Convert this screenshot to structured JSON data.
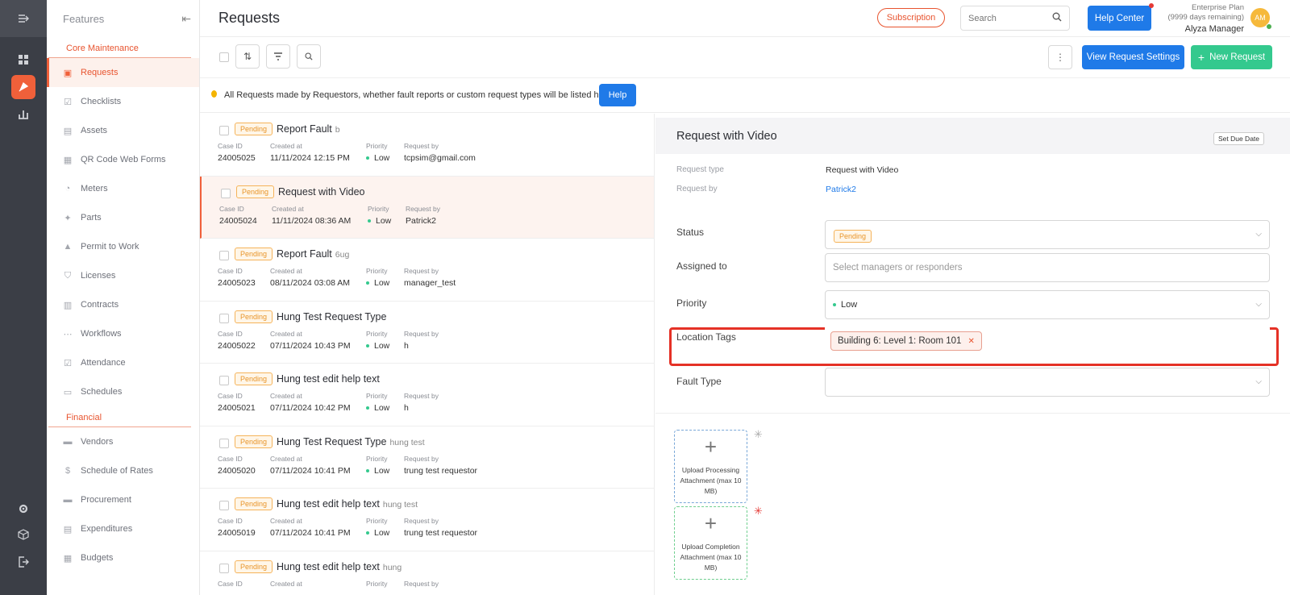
{
  "app": {
    "page_title": "Requests",
    "features_title": "Features"
  },
  "colors": {
    "accent": "#f0603a",
    "primary": "#1f7ae8",
    "success": "#34c98e",
    "pending": "#e8952a",
    "rail": "#3b3e46"
  },
  "rail": {
    "items": [
      {
        "icon": "dashboard-icon"
      },
      {
        "icon": "rocket-icon",
        "active": true
      },
      {
        "icon": "analytics-icon"
      },
      {
        "icon": "settings-gear-icon"
      },
      {
        "icon": "cube-icon"
      },
      {
        "icon": "logout-icon"
      }
    ]
  },
  "sidebar": {
    "sections": [
      {
        "title": "Core Maintenance",
        "items": [
          {
            "label": "Requests",
            "icon": "request-icon",
            "active": true
          },
          {
            "label": "Checklists",
            "icon": "checklist-icon"
          },
          {
            "label": "Assets",
            "icon": "asset-icon"
          },
          {
            "label": "QR Code Web Forms",
            "icon": "qr-code-icon"
          },
          {
            "label": "Meters",
            "icon": "meter-icon"
          },
          {
            "label": "Parts",
            "icon": "parts-icon"
          },
          {
            "label": "Permit to Work",
            "icon": "permit-icon"
          },
          {
            "label": "Licenses",
            "icon": "shield-icon"
          },
          {
            "label": "Contracts",
            "icon": "contract-icon"
          },
          {
            "label": "Workflows",
            "icon": "workflow-icon"
          },
          {
            "label": "Attendance",
            "icon": "attendance-icon"
          },
          {
            "label": "Schedules",
            "icon": "calendar-icon"
          }
        ]
      },
      {
        "title": "Financial",
        "items": [
          {
            "label": "Vendors",
            "icon": "vendor-icon"
          },
          {
            "label": "Schedule of Rates",
            "icon": "dollar-icon"
          },
          {
            "label": "Procurement",
            "icon": "procurement-icon"
          },
          {
            "label": "Expenditures",
            "icon": "expenditure-icon"
          },
          {
            "label": "Budgets",
            "icon": "budget-icon"
          }
        ]
      }
    ]
  },
  "header": {
    "subscription_label": "Subscription",
    "search_placeholder": "Search",
    "help_center_label": "Help Center",
    "plan_name": "Enterprise Plan",
    "plan_remaining": "(9999 days remaining)",
    "user_name": "Alyza Manager",
    "avatar_initials": "AM"
  },
  "toolbar": {
    "view_settings_label": "View Request Settings",
    "new_request_label": "New Request"
  },
  "infobar": {
    "text": "All Requests made by Requestors, whether fault reports or custom request types will be listed here.",
    "help_label": "Help"
  },
  "list": {
    "col_case_id": "Case ID",
    "col_created_at": "Created at",
    "col_priority": "Priority",
    "col_request_by": "Request by",
    "requests": [
      {
        "status": "Pending",
        "title": "Report Fault",
        "subtitle": "b",
        "case_id": "24005025",
        "created_at": "11/11/2024 12:15 PM",
        "priority": "Low",
        "request_by": "tcpsim@gmail.com"
      },
      {
        "status": "Pending",
        "title": "Request with Video",
        "subtitle": "",
        "case_id": "24005024",
        "created_at": "11/11/2024 08:36 AM",
        "priority": "Low",
        "request_by": "Patrick2",
        "active": true
      },
      {
        "status": "Pending",
        "title": "Report Fault",
        "subtitle": "6ug",
        "case_id": "24005023",
        "created_at": "08/11/2024 03:08 AM",
        "priority": "Low",
        "request_by": "manager_test"
      },
      {
        "status": "Pending",
        "title": "Hung Test Request Type",
        "subtitle": "",
        "case_id": "24005022",
        "created_at": "07/11/2024 10:43 PM",
        "priority": "Low",
        "request_by": "h"
      },
      {
        "status": "Pending",
        "title": "Hung test edit help text",
        "subtitle": "",
        "case_id": "24005021",
        "created_at": "07/11/2024 10:42 PM",
        "priority": "Low",
        "request_by": "h"
      },
      {
        "status": "Pending",
        "title": "Hung Test Request Type",
        "subtitle": "hung test",
        "case_id": "24005020",
        "created_at": "07/11/2024 10:41 PM",
        "priority": "Low",
        "request_by": "trung test requestor"
      },
      {
        "status": "Pending",
        "title": "Hung test edit help text",
        "subtitle": "hung test",
        "case_id": "24005019",
        "created_at": "07/11/2024 10:41 PM",
        "priority": "Low",
        "request_by": "trung test requestor"
      },
      {
        "status": "Pending",
        "title": "Hung test edit help text",
        "subtitle": "hung",
        "case_id": "",
        "created_at": "",
        "priority": "",
        "request_by": ""
      }
    ]
  },
  "detail": {
    "title": "Request with Video",
    "set_due_date_label": "Set Due Date",
    "request_type_label": "Request type",
    "request_type_value": "Request with Video",
    "request_by_label": "Request by",
    "request_by_value": "Patrick2",
    "status_label": "Status",
    "status_value": "Pending",
    "assigned_label": "Assigned to",
    "assigned_placeholder": "Select managers or responders",
    "priority_label": "Priority",
    "priority_value": "Low",
    "location_label": "Location Tags",
    "location_tag": "Building 6: Level 1: Room 101",
    "fault_type_label": "Fault Type",
    "upload_processing": "Upload Processing Attachment (max 10 MB)",
    "upload_completion": "Upload Completion Attachment (max 10 MB)"
  }
}
